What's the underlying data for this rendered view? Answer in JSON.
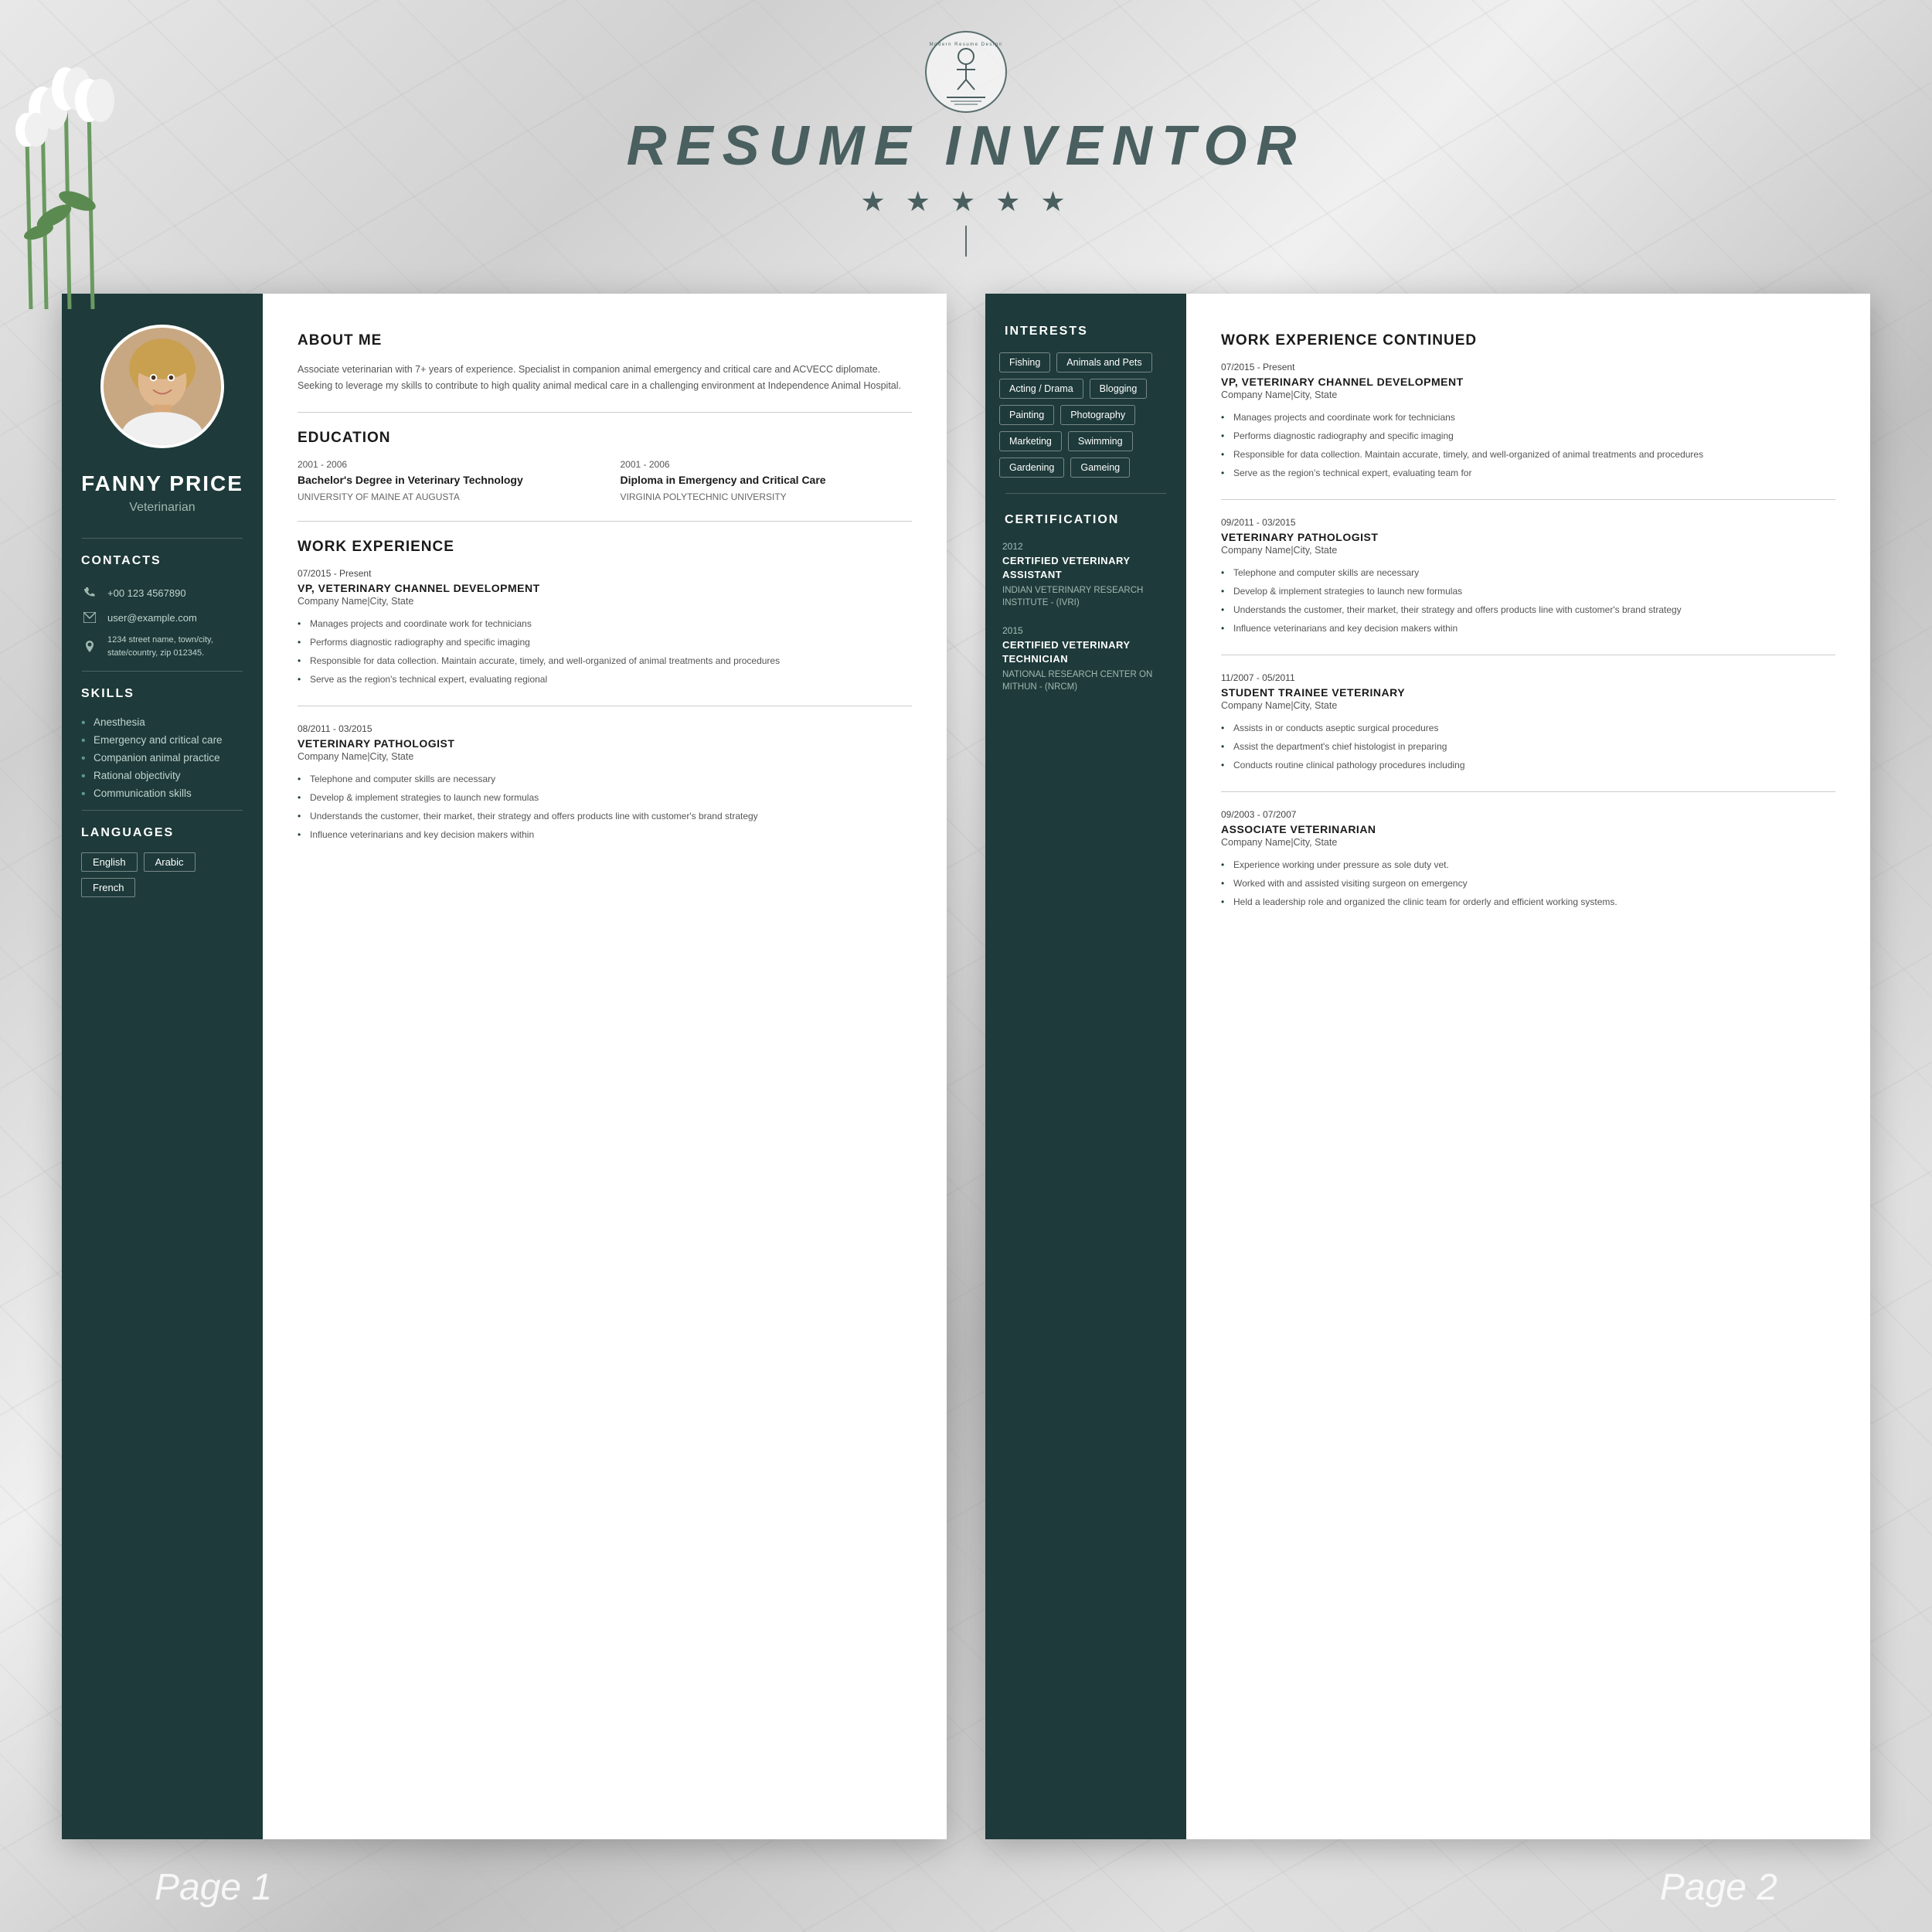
{
  "header": {
    "logo_text": "Modern Resume Design",
    "site_title": "RESUME INVENTOR",
    "stars": "★ ★ ★ ★ ★"
  },
  "page1": {
    "sidebar": {
      "name": "FANNY PRICE",
      "title": "Veterinarian",
      "sections": {
        "contacts": {
          "label": "CONTACTS",
          "items": [
            {
              "icon": "phone",
              "text": "+00 123 4567890"
            },
            {
              "icon": "email",
              "text": "user@example.com"
            },
            {
              "icon": "address",
              "text": "1234 street name, town/city, state/country, zip 012345."
            }
          ]
        },
        "skills": {
          "label": "SKILLS",
          "items": [
            "Anesthesia",
            "Emergency and critical care",
            "Companion animal practice",
            "Rational objectivity",
            "Communication skills"
          ]
        },
        "languages": {
          "label": "LANGUAGES",
          "items": [
            "English",
            "Arabic",
            "French"
          ]
        }
      }
    },
    "main": {
      "about": {
        "heading": "ABOUT ME",
        "text": "Associate veterinarian with 7+ years of experience. Specialist in companion animal emergency and critical care and ACVECC diplomate. Seeking to leverage my skills to contribute to high quality animal medical care in a challenging environment at Independence Animal Hospital."
      },
      "education": {
        "heading": "EDUCATION",
        "items": [
          {
            "years": "2001 - 2006",
            "degree": "Bachelor's Degree in Veterinary Technology",
            "school": "UNIVERSITY OF MAINE AT AUGUSTA"
          },
          {
            "years": "2001 - 2006",
            "degree": "Diploma in Emergency and Critical Care",
            "school": "VIRGINIA POLYTECHNIC UNIVERSITY"
          }
        ]
      },
      "work_experience": {
        "heading": "WORK EXPERIENCE",
        "jobs": [
          {
            "date": "07/2015 - Present",
            "title": "VP, VETERINARY CHANNEL DEVELOPMENT",
            "company": "Company Name|City, State",
            "bullets": [
              "Manages projects and coordinate work for technicians",
              "Performs diagnostic radiography and specific imaging",
              "Responsible for data collection. Maintain accurate, timely, and well-organized of animal treatments and procedures",
              "Serve as the region's technical expert, evaluating regional"
            ]
          },
          {
            "date": "08/2011 - 03/2015",
            "title": "VETERINARY PATHOLOGIST",
            "company": "Company Name|City, State",
            "bullets": [
              "Telephone and computer skills are necessary",
              "Develop & implement strategies to launch new formulas",
              "Understands the customer, their market, their strategy and offers products line with customer's brand strategy",
              "Influence veterinarians and key decision makers within"
            ]
          }
        ]
      }
    }
  },
  "page2": {
    "sidebar": {
      "interests": {
        "heading": "INTERESTS",
        "tags": [
          "Fishing",
          "Animals and Pets",
          "Acting / Drama",
          "Blogging",
          "Painting",
          "Photography",
          "Marketing",
          "Swimming",
          "Gardening",
          "Gameing"
        ]
      },
      "certification": {
        "heading": "CERTIFICATION",
        "items": [
          {
            "year": "2012",
            "title": "CERTIFIED VETERINARY ASSISTANT",
            "org": "INDIAN VETERINARY RESEARCH INSTITUTE - (IVRI)"
          },
          {
            "year": "2015",
            "title": "CERTIFIED VETERINARY TECHNICIAN",
            "org": "NATIONAL RESEARCH CENTER ON MITHUN - (NRCM)"
          }
        ]
      }
    },
    "main": {
      "heading": "WORK EXPERIENCE CONTINUED",
      "jobs": [
        {
          "date": "07/2015 - Present",
          "title": "VP, VETERINARY CHANNEL DEVELOPMENT",
          "company": "Company Name|City, State",
          "bullets": [
            "Manages projects and coordinate work for technicians",
            "Performs diagnostic radiography and specific imaging",
            "Responsible for data collection. Maintain accurate, timely, and well-organized of animal treatments and procedures",
            "Serve as the region's technical expert, evaluating team for"
          ]
        },
        {
          "date": "09/2011 - 03/2015",
          "title": "VETERINARY PATHOLOGIST",
          "company": "Company Name|City, State",
          "bullets": [
            "Telephone and computer skills are necessary",
            "Develop & implement strategies to launch new formulas",
            "Understands the customer, their market, their strategy and offers products line with customer's brand strategy",
            "Influence veterinarians and key decision makers within"
          ]
        },
        {
          "date": "11/2007 - 05/2011",
          "title": "STUDENT TRAINEE VETERINARY",
          "company": "Company Name|City, State",
          "bullets": [
            "Assists in or conducts aseptic surgical procedures",
            "Assist the department's chief histologist in preparing",
            "Conducts routine clinical pathology procedures including"
          ]
        },
        {
          "date": "09/2003 - 07/2007",
          "title": "ASSOCIATE VETERINARIAN",
          "company": "Company Name|City, State",
          "bullets": [
            "Experience working under pressure as sole duty vet.",
            "Worked with and assisted visiting surgeon on emergency",
            "Held a leadership role and organized the clinic team for orderly and efficient working systems."
          ]
        }
      ]
    }
  },
  "footer": {
    "page1_label": "Page 1",
    "page2_label": "Page 2"
  }
}
